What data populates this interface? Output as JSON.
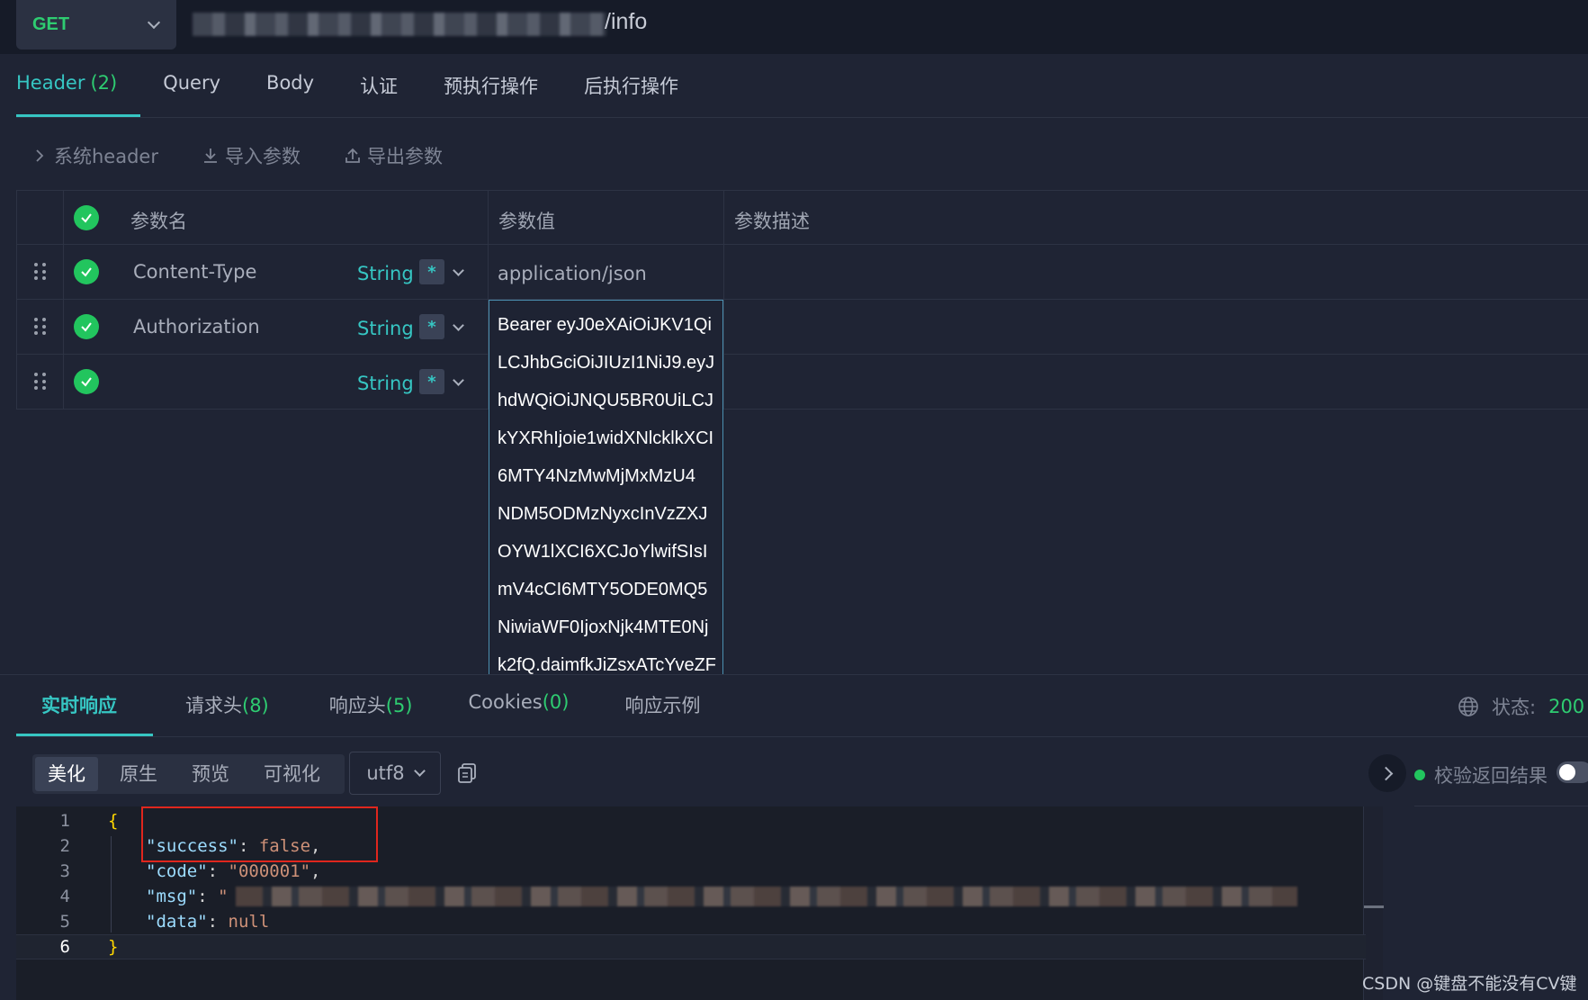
{
  "request": {
    "method": "GET",
    "url_suffix": "/info"
  },
  "req_tabs": [
    {
      "label": "Header",
      "count": "(2)",
      "active": true
    },
    {
      "label": "Query",
      "count": "",
      "active": false
    },
    {
      "label": "Body",
      "count": "",
      "active": false
    },
    {
      "label": "认证",
      "count": "",
      "active": false
    },
    {
      "label": "预执行操作",
      "count": "",
      "active": false
    },
    {
      "label": "后执行操作",
      "count": "",
      "active": false
    }
  ],
  "actions": {
    "system_header": "系统header",
    "import": "导入参数",
    "export": "导出参数"
  },
  "table": {
    "headers": {
      "name": "参数名",
      "value": "参数值",
      "desc": "参数描述"
    },
    "required_mark": "*",
    "rows": [
      {
        "name": "Content-Type",
        "type": "String",
        "value": "application/json"
      },
      {
        "name": "Authorization",
        "type": "String",
        "value": ""
      },
      {
        "name": "",
        "type": "String",
        "value": ""
      }
    ],
    "token_lines": [
      "Bearer eyJ0eXAiOiJKV1Qi",
      "LCJhbGciOiJIUzI1NiJ9.eyJ",
      "hdWQiOiJNQU5BR0UiLCJ",
      "kYXRhIjoie1widXNlcklkXCI",
      "6MTY4NzMwMjMxMzU4",
      "NDM5ODMzNyxcInVzZXJ",
      "OYW1lXCI6XCJoYlwifSIsI",
      "mV4cCI6MTY5ODE0MQ5",
      "NiwiaWF0IjoxNjk4MTE0Nj",
      "k2fQ.daimfkJiZsxATcYveZF"
    ]
  },
  "resp_tabs": [
    {
      "label": "实时响应",
      "count": "",
      "active": true
    },
    {
      "label": "请求头",
      "count": "(8)",
      "active": false
    },
    {
      "label": "响应头",
      "count": "(5)",
      "active": false
    },
    {
      "label": "Cookies",
      "count": "(0)",
      "active": false
    },
    {
      "label": "响应示例",
      "count": "",
      "active": false
    }
  ],
  "status": {
    "label": "状态:",
    "value": "200"
  },
  "view_modes": [
    {
      "label": "美化",
      "active": true
    },
    {
      "label": "原生",
      "active": false
    },
    {
      "label": "预览",
      "active": false
    },
    {
      "label": "可视化",
      "active": false
    }
  ],
  "encoding": "utf8",
  "verify_label": "校验返回结果",
  "code": {
    "line_numbers": [
      "1",
      "2",
      "3",
      "4",
      "5",
      "6"
    ],
    "open_brace": "{",
    "close_brace": "}",
    "success_key": "\"success\"",
    "success_val": "false",
    "code_key": "\"code\"",
    "code_val": "\"000001\"",
    "msg_key": "\"msg\"",
    "msg_val_start": "\"",
    "data_key": "\"data\"",
    "data_val": "null"
  },
  "watermark": "CSDN @键盘不能没有CV键"
}
